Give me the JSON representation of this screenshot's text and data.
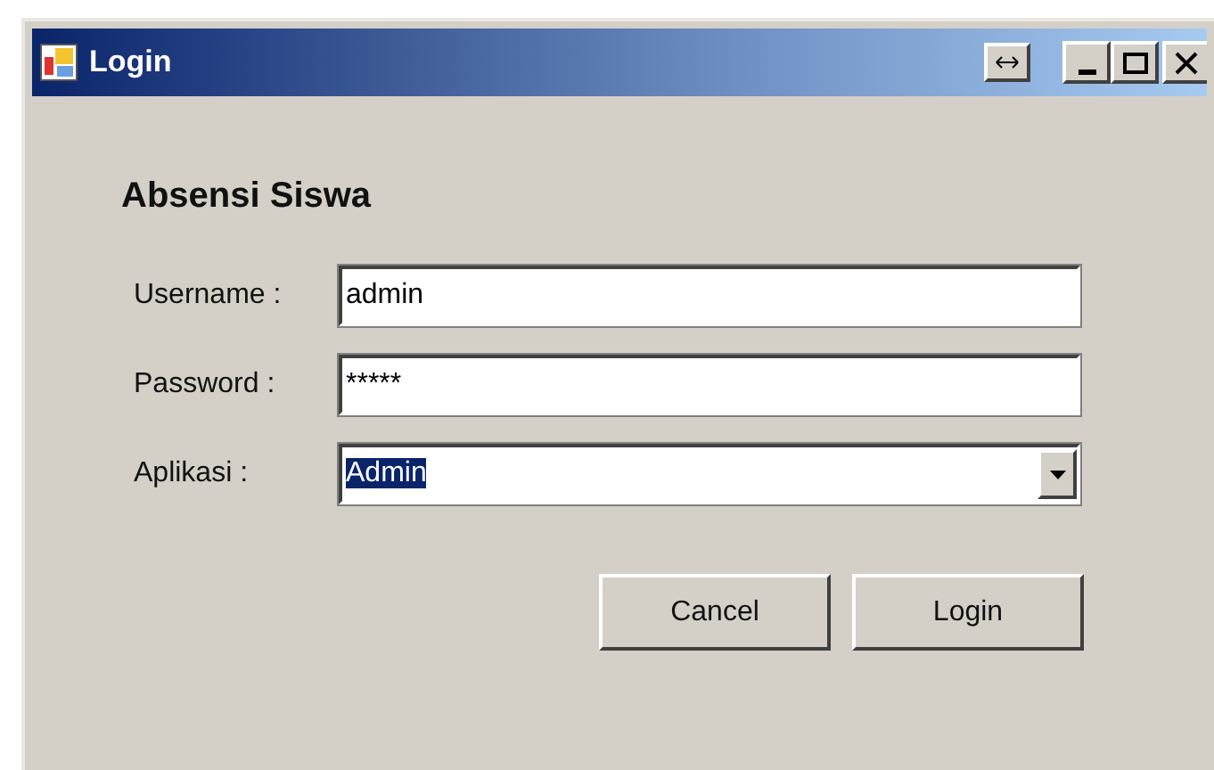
{
  "window": {
    "title": "Login"
  },
  "heading": "Absensi Siswa",
  "fields": [
    {
      "kind": "text",
      "label": "Username :",
      "value": "admin"
    },
    {
      "kind": "text",
      "label": "Password :",
      "value": "*****"
    },
    {
      "kind": "combo",
      "label": "Aplikasi :",
      "value": "Admin",
      "selected": true
    }
  ],
  "buttons": [
    "Cancel",
    "Login"
  ]
}
